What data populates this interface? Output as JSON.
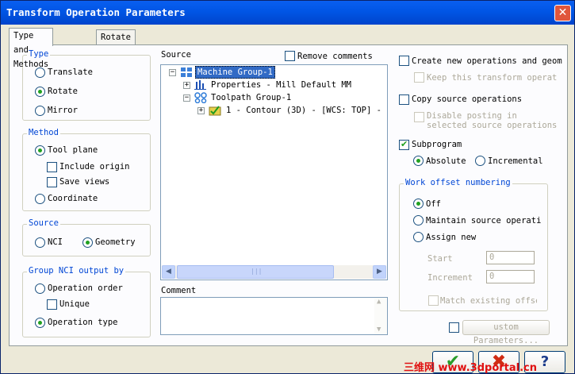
{
  "window": {
    "title": "Transform Operation Parameters",
    "close_icon": "close-icon"
  },
  "tabs": [
    {
      "label": "Type and Methods",
      "active": true
    },
    {
      "label": "Rotate",
      "active": false
    }
  ],
  "type_group": {
    "title": "Type",
    "options": [
      {
        "label": "Translate",
        "selected": false
      },
      {
        "label": "Rotate",
        "selected": true
      },
      {
        "label": "Mirror",
        "selected": false
      }
    ]
  },
  "method_group": {
    "title": "Method",
    "tool_plane": "Tool plane",
    "include_origin": "Include origin",
    "save_views": "Save views",
    "coordinate": "Coordinate"
  },
  "source_group": {
    "title": "Source",
    "nci": "NCI",
    "geometry": "Geometry"
  },
  "group_nci": {
    "title": "Group NCI output by",
    "operation_order": "Operation order",
    "unique_label": "Unique",
    "operation_type": "Operation type"
  },
  "source_tree": {
    "label": "Source",
    "remove_comments": "Remove comments",
    "items": [
      {
        "label": "Machine Group-1",
        "icon": "machine-group-icon"
      },
      {
        "label": "Properties - Mill Default MM",
        "icon": "properties-icon"
      },
      {
        "label": "Toolpath Group-1",
        "icon": "toolpath-group-icon"
      },
      {
        "label": "1 - Contour (3D) - [WCS: TOP] - [T",
        "icon": "operation-folder-icon"
      }
    ],
    "scroll_thumb_grip": "|||"
  },
  "comment": {
    "label": "Comment",
    "value": ""
  },
  "right_panel": {
    "create_new_ops": "Create new operations and geom",
    "keep_transform": "Keep this transform operat",
    "copy_source_ops": "Copy source operations",
    "disable_posting_1": "Disable posting in",
    "disable_posting_2": "selected source operations",
    "subprogram": "Subprogram",
    "absolute": "Absolute",
    "incremental": "Incremental"
  },
  "work_offset": {
    "title": "Work offset numbering",
    "off": "Off",
    "maintain": "Maintain source operation",
    "assign_new": "Assign new",
    "start_label": "Start",
    "start_value": "0",
    "increment_label": "Increment",
    "increment_value": "0",
    "match_existing": "Match existing offse"
  },
  "custom_params": {
    "label": "ustom Parameters..."
  },
  "footer": {
    "ok_icon": "checkmark-icon",
    "cancel_icon": "cancel-x-icon",
    "help_icon": "help-icon",
    "ok_glyph": "✔",
    "cancel_glyph": "✖",
    "help_glyph": "?",
    "watermark": "三维网 www.3dportal.cn"
  },
  "colors": {
    "title_bar": "#0055e5",
    "group_title": "#0046d5",
    "panel_bg": "#ece9d8"
  }
}
